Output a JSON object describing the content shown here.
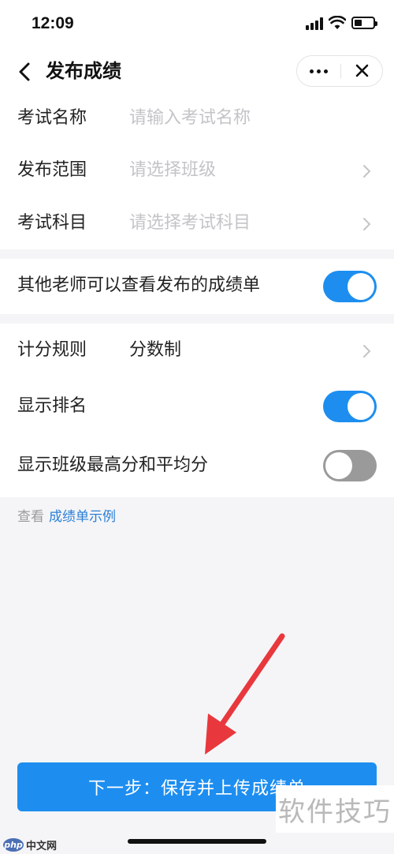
{
  "status_bar": {
    "time": "12:09"
  },
  "nav": {
    "title": "发布成绩"
  },
  "form": {
    "exam_name": {
      "label": "考试名称",
      "placeholder": "请输入考试名称"
    },
    "scope": {
      "label": "发布范围",
      "placeholder": "请选择班级"
    },
    "subject": {
      "label": "考试科目",
      "placeholder": "请选择考试科目"
    }
  },
  "visibility": {
    "label": "其他老师可以查看发布的成绩单",
    "enabled": true
  },
  "settings": {
    "scoring": {
      "label": "计分规则",
      "value": "分数制"
    },
    "show_rank": {
      "label": "显示排名",
      "enabled": true
    },
    "show_class_stats": {
      "label": "显示班级最高分和平均分",
      "enabled": false
    }
  },
  "hint": {
    "prefix": "查看",
    "link": "成绩单示例"
  },
  "primary_button": {
    "label": "下一步：保存并上传成绩单"
  },
  "watermarks": {
    "bottom_right": "软件技巧",
    "bottom_left_logo": "php",
    "bottom_left_text": "中文网"
  },
  "colors": {
    "accent": "#1d8ef0",
    "toggle_off": "#9a9a9a",
    "link": "#2a7fd6",
    "arrow": "#e8383d"
  }
}
